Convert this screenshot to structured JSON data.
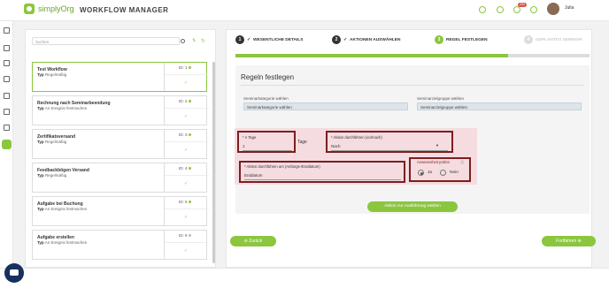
{
  "app": {
    "logo_text": "simplyOrg",
    "title": "WORKFLOW MANAGER",
    "user_name": "Julia",
    "notification_badge": "203"
  },
  "search": {
    "placeholder": "Suchen"
  },
  "workflows": [
    {
      "name": "Test Workflow",
      "type_label": "Typ",
      "type": "Regelmäßig",
      "count": "1",
      "selected": true
    },
    {
      "name": "Rechnung nach Seminarbeendung",
      "type_label": "Typ",
      "type": "An Ereignis festmachen",
      "count": "2",
      "selected": false
    },
    {
      "name": "Zertifikatsversand",
      "type_label": "Typ",
      "type": "Regelmäßig",
      "count": "3",
      "selected": false
    },
    {
      "name": "Feedbackbögen Versand",
      "type_label": "Typ",
      "type": "Regelmäßig",
      "count": "4",
      "selected": false
    },
    {
      "name": "Aufgabe bei Buchung",
      "type_label": "Typ",
      "type": "An Ereignis festmachen",
      "count": "5",
      "selected": false
    },
    {
      "name": "Aufgabe erstellen",
      "type_label": "Typ",
      "type": "An Ereignis festmachen",
      "count": "6",
      "selected": false
    }
  ],
  "steps": [
    {
      "num": "1",
      "label": "WESENTLICHE DETAILS"
    },
    {
      "num": "2",
      "label": "AKTIONEN AUSWÄHLEN"
    },
    {
      "num": "3",
      "label": "REGEL FESTLEGEN"
    },
    {
      "num": "4",
      "label": "GEPLANTES SEMINAR"
    }
  ],
  "progress": 0.77,
  "rules": {
    "title": "Regeln festlegen",
    "kategorie_label": "Seminarkategorie wählen",
    "kategorie_value": "Seminarkategorie wählen",
    "gruppe_label": "Seminarzielgruppe wählen",
    "gruppe_value": "Seminarzielgruppe wählen"
  },
  "condition": {
    "n_tage_label": "* n Tage",
    "n_tage_value": "1",
    "tage_label": "Tage",
    "ausfuehren_label": "* Aktion durchführen (vor/nach)",
    "ausfuehren_value": "Nach",
    "am_label": "* Aktion durchführen am (Anfangs-/Enddatum)",
    "am_value": "Enddatum",
    "anwesenheit_label": "Anwesenheit prüfen",
    "ja_label": "Ja",
    "nein_label": "Nein"
  },
  "buttons": {
    "ausfuehrung": "Aktion zur Ausführung wählen",
    "zurueck": "Zurück",
    "fortfahren": "Fortfahren"
  }
}
